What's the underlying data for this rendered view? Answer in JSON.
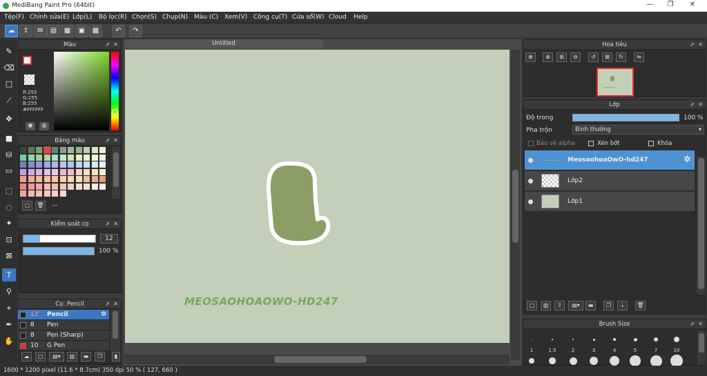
{
  "app": {
    "title": "MediBang Paint Pro (64bit)"
  },
  "menu": [
    "Tệp(F)",
    "Chỉnh sửa(E)",
    "Lớp(L)",
    "Bộ lọc(R)",
    "Chọn(S)",
    "Chụp(N)",
    "Màu (C)",
    "Xem(V)",
    "Công cụ(T)",
    "Cửa sổ(W)",
    "Cloud",
    "Help"
  ],
  "window_controls": {
    "minimize": "—",
    "maximize": "❐",
    "close": "✕"
  },
  "panels": {
    "color": {
      "title": "Màu",
      "r": "R:255",
      "g": "G:255",
      "b": "B:255",
      "hex": "#FFFFFF"
    },
    "palette": {
      "title": "Bảng màu",
      "status": "---"
    },
    "brush_control": {
      "title": "Kiểm soát cọ",
      "size": "12",
      "opacity": "100 %"
    },
    "brush": {
      "title": "Cọ: Pencil",
      "items": [
        {
          "size": "12",
          "name": "Pencil",
          "color": "#222222"
        },
        {
          "size": "8",
          "name": "Pen",
          "color": "#222222"
        },
        {
          "size": "8",
          "name": "Pen (Sharp)",
          "color": "#222222"
        },
        {
          "size": "10",
          "name": "G Pen",
          "color": "#e53030"
        }
      ]
    },
    "navigator": {
      "title": "Hoa tiêu"
    },
    "layer": {
      "title": "Lớp",
      "opacity_label": "Độ trong",
      "opacity_value": "100 %",
      "blend_label": "Pha trộn",
      "blend_value": "Bình thường",
      "protect_alpha": "Bảo vệ alpha",
      "clipping": "Xén bớt",
      "lock": "Khóa",
      "layers": [
        {
          "name": "MeosaohoaOwO-hd247",
          "selected": true
        },
        {
          "name": "Lớp2",
          "selected": false
        },
        {
          "name": "Lớp1",
          "selected": false
        }
      ]
    },
    "brush_size": {
      "title": "Brush Size",
      "sizes": [
        "1",
        "1.5",
        "2",
        "3",
        "4",
        "5",
        "7",
        "10"
      ]
    }
  },
  "document": {
    "tab": "Untitled",
    "watermark": "MEOSAOHOAOWO-HD247"
  },
  "status": {
    "text": "1600 * 1200 pixel   (11.6 * 8.7cm)   350 dpi   50 %   ( 127, 660 )"
  },
  "colors": {
    "accent": "#3c78c0",
    "canvas": "#c3cfb8",
    "shape_fill": "#8c9e68",
    "watermark": "#78a85a",
    "layer_selected": "#4f92d2"
  }
}
